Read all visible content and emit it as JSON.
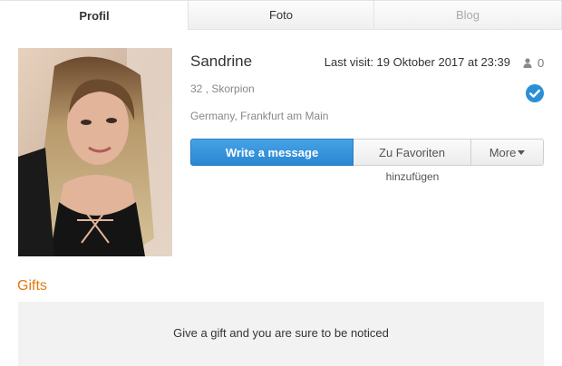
{
  "tabs": [
    {
      "label": "Profil"
    },
    {
      "label": "Foto"
    },
    {
      "label": "Blog"
    }
  ],
  "profile": {
    "name": "Sandrine",
    "last_visit": "Last visit: 19 Oktober 2017 at 23:39",
    "visitor_count": "0",
    "age_sign": "32 , Skorpion",
    "location": "Germany, Frankfurt am Main",
    "verified_icon": "check-circle-icon",
    "verified_color": "#2b8fd6"
  },
  "actions": {
    "write_label": "Write a message",
    "favorite_label": "Zu Favoriten",
    "favorite_label_cont": "hinzufügen",
    "more_label": "More"
  },
  "gifts": {
    "title": "Gifts",
    "message": "Give a gift and you are sure to be noticed",
    "title_color": "#e07a10"
  }
}
